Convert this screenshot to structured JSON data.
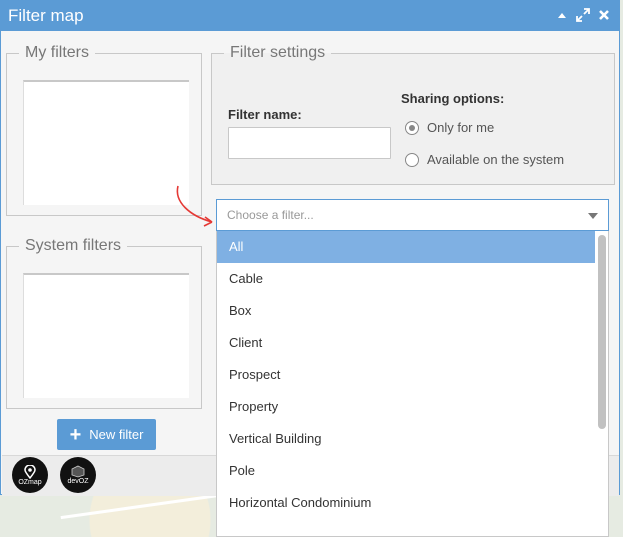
{
  "window": {
    "title": "Filter map",
    "controls": [
      "minimize-icon",
      "maximize-icon",
      "close-icon"
    ]
  },
  "my_filters": {
    "legend": "My filters"
  },
  "filter_settings": {
    "legend": "Filter settings",
    "filter_name_label": "Filter name:",
    "filter_name_value": "",
    "sharing_label": "Sharing options:",
    "sharing_options": [
      {
        "label": "Only for me",
        "selected": true
      },
      {
        "label": "Available on the system",
        "selected": false
      }
    ]
  },
  "system_filters": {
    "legend": "System filters"
  },
  "filter_select": {
    "placeholder": "Choose a filter...",
    "options": [
      "All",
      "Cable",
      "Box",
      "Client",
      "Prospect",
      "Property",
      "Vertical Building",
      "Pole",
      "Horizontal Condominium"
    ],
    "highlighted": "All"
  },
  "buttons": {
    "new_filter": "New filter"
  },
  "logos": {
    "ozmap": "OZmap",
    "devoz": "devOZ"
  },
  "colors": {
    "accent": "#5b9bd5",
    "highlight": "#7fb0e3",
    "annotation_arrow": "#e53935"
  }
}
